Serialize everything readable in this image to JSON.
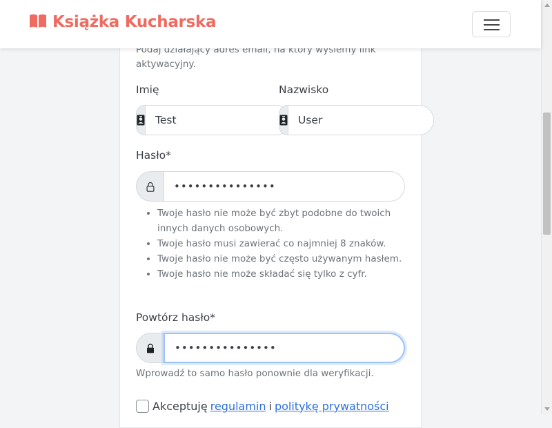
{
  "navbar": {
    "brand_text": "Książka Kucharska",
    "brand_icon": "book-open-icon",
    "toggler_icon": "hamburger-menu-icon",
    "brand_color": "#f16a5f"
  },
  "form": {
    "email_help": "Podaj działający adres email, na który wyślemy link aktywacyjny.",
    "first_name": {
      "label": "Imię",
      "value": "Test",
      "icon": "person-badge-icon"
    },
    "last_name": {
      "label": "Nazwisko",
      "value": "User",
      "icon": "person-badge-icon"
    },
    "password": {
      "label": "Hasło*",
      "value": "•••••••••••••••",
      "icon": "lock-outline-icon"
    },
    "password_rules": [
      "Twoje hasło nie może być zbyt podobne do twoich innych danych osobowych.",
      "Twoje hasło musi zawierać co najmniej 8 znaków.",
      "Twoje hasło nie może być często używanym hasłem.",
      "Twoje hasło nie może składać się tylko z cyfr."
    ],
    "password_confirm": {
      "label": "Powtórz hasło*",
      "value": "•••••••••••••••",
      "icon": "lock-filled-icon",
      "help": "Wprowadź to samo hasło ponownie dla weryfikacji."
    },
    "terms": {
      "checked": false,
      "prefix": "Akceptuję",
      "link_terms": "regulamin",
      "conjunction": "i",
      "link_privacy": "politykę prywatności"
    }
  },
  "colors": {
    "link": "#2c6fe0",
    "focus_ring": "#9ec2f5",
    "muted_text": "#6c737a"
  }
}
